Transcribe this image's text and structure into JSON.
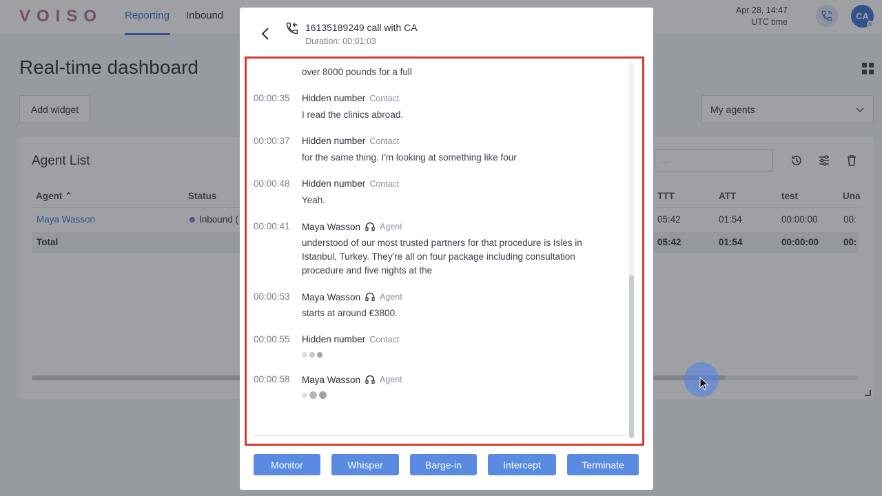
{
  "app": {
    "logo": "VOISO",
    "nav": [
      "Reporting",
      "Inbound"
    ],
    "clock": {
      "time": "Apr 28, 14:47",
      "zone": "UTC time"
    },
    "avatar": "CA"
  },
  "dashboard": {
    "title": "Real-time dashboard",
    "add_widget": "Add widget",
    "agents_select": "My agents",
    "widget": {
      "title": "Agent List",
      "search_placeholder": "...",
      "columns_left": [
        "Agent",
        "Status"
      ],
      "columns_right": [
        "TTT",
        "ATT",
        "test",
        "Una"
      ],
      "row": {
        "agent": "Maya Wasson",
        "status": "Inbound (",
        "ttt": "05:42",
        "att": "01:54",
        "test": "00:00:00",
        "una": "00:"
      },
      "total": {
        "label": "Total",
        "ttt": "05:42",
        "att": "01:54",
        "test": "00:00:00",
        "una": "00:"
      }
    }
  },
  "modal": {
    "call_title": "16135189249 call with CA",
    "duration": "Duration: 00:01:03",
    "transcript": [
      {
        "time": "",
        "name": "",
        "role": "",
        "text": "over 8000 pounds for a full"
      },
      {
        "time": "00:00:35",
        "name": "Hidden number",
        "role": "Contact",
        "agent": false,
        "text": "I read the clinics abroad."
      },
      {
        "time": "00:00:37",
        "name": "Hidden number",
        "role": "Contact",
        "agent": false,
        "text": "for the same thing. I'm looking at something like four"
      },
      {
        "time": "00:00:48",
        "name": "Hidden number",
        "role": "Contact",
        "agent": false,
        "text": "Yeah."
      },
      {
        "time": "00:00:41",
        "name": "Maya Wasson",
        "role": "Agent",
        "agent": true,
        "text": "understood of our most trusted partners for that procedure is Isles in Istanbul, Turkey. They're all on four package including consultation procedure and five nights at the"
      },
      {
        "time": "00:00:53",
        "name": "Maya Wasson",
        "role": "Agent",
        "agent": true,
        "text": "starts at around €3800."
      },
      {
        "time": "00:00:55",
        "name": "Hidden number",
        "role": "Contact",
        "agent": false,
        "text": ""
      },
      {
        "time": "00:00:58",
        "name": "Maya Wasson",
        "role": "Agent",
        "agent": true,
        "text": ""
      }
    ],
    "actions": [
      "Monitor",
      "Whisper",
      "Barge-in",
      "Intercept",
      "Terminate"
    ]
  },
  "colors": {
    "accent": "#3b6fd8",
    "button": "#5b8ae3",
    "highlight_frame": "#d9392f"
  }
}
